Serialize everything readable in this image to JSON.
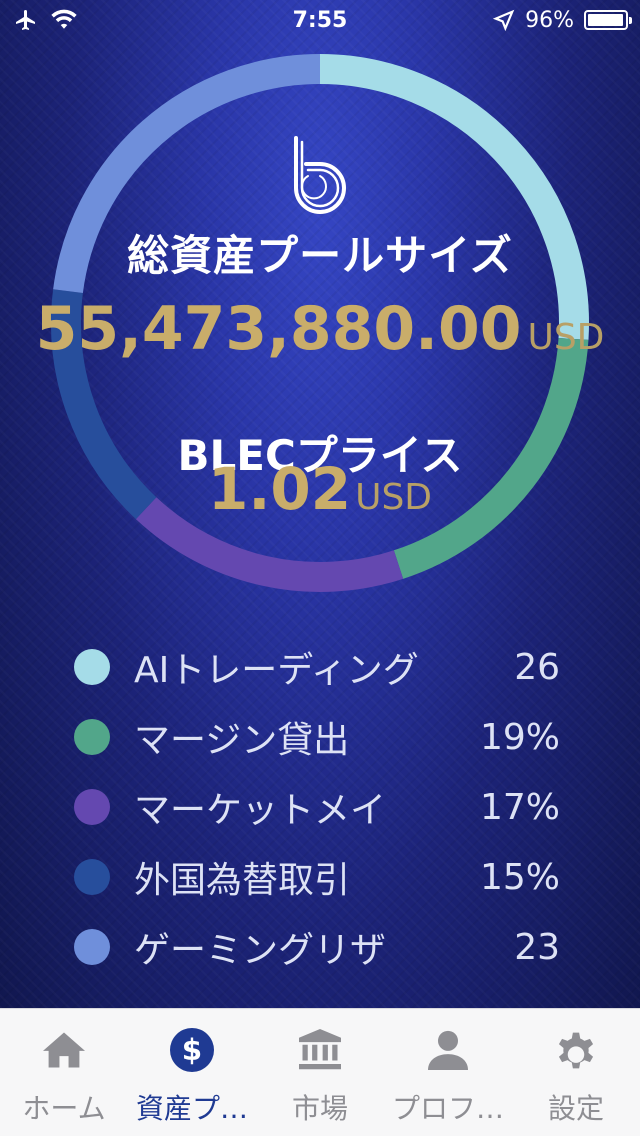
{
  "status_bar": {
    "time": "7:55",
    "battery_text": "96%",
    "battery_level": 0.96
  },
  "pool": {
    "title": "総資産プールサイズ",
    "value": "55,473,880.00",
    "unit": "USD"
  },
  "price": {
    "title": "BLECプライス",
    "value": "1.02",
    "unit": "USD"
  },
  "legend": [
    {
      "label": "AIトレーディング",
      "value": "26",
      "color": "#a5dce8"
    },
    {
      "label": "マージン貸出",
      "value": "19%",
      "color": "#52a68a"
    },
    {
      "label": "マーケットメイ",
      "value": "17%",
      "color": "#6448b0"
    },
    {
      "label": "外国為替取引",
      "value": "15%",
      "color": "#274e9c"
    },
    {
      "label": "ゲーミングリザ",
      "value": "23",
      "color": "#6f8fdb"
    }
  ],
  "ring": {
    "segments": [
      {
        "value": 26,
        "color": "#a5dce8"
      },
      {
        "value": 19,
        "color": "#52a68a"
      },
      {
        "value": 17,
        "color": "#6448b0"
      },
      {
        "value": 15,
        "color": "#274e9c"
      },
      {
        "value": 23,
        "color": "#6f8fdb"
      }
    ]
  },
  "tabs": [
    {
      "label": "ホーム",
      "icon": "home-icon",
      "active": false
    },
    {
      "label": "資産プ…",
      "icon": "dollar-icon",
      "active": true
    },
    {
      "label": "市場",
      "icon": "bank-icon",
      "active": false
    },
    {
      "label": "プロフ…",
      "icon": "person-icon",
      "active": false
    },
    {
      "label": "設定",
      "icon": "gear-icon",
      "active": false
    }
  ],
  "colors": {
    "accent": "#1f3a93",
    "gold": "#c9ad6a",
    "tab_inactive": "#8e8e93"
  }
}
